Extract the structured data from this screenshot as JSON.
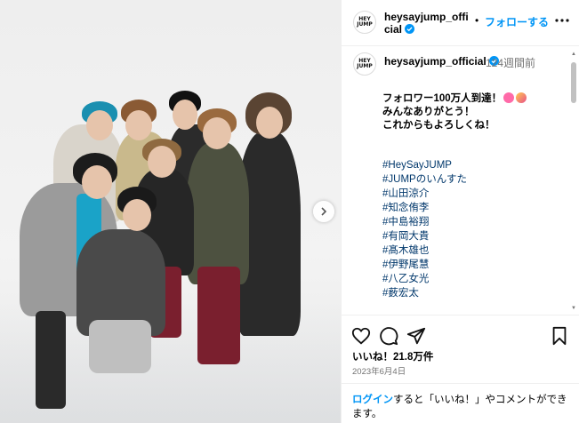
{
  "header": {
    "username": "heysayjump_official",
    "separator": "•",
    "follow_label": "フォローする",
    "logo_text": "HEY SAY JUMP"
  },
  "caption": {
    "username": "heysayjump_official",
    "time": "124週間前",
    "lines": [
      "フォロワー100万人到達！",
      "みんなありがとう！",
      "これからもよろしくね！"
    ],
    "hashtags": [
      "#HeySayJUMP",
      "#JUMPのいんすた",
      "#山田涼介",
      "#知念侑李",
      "#中島裕翔",
      "#有岡大貴",
      "#髙木雄也",
      "#伊野尾慧",
      "#八乙女光",
      "#薮宏太"
    ]
  },
  "stats": {
    "likes": "いいね！21.8万件",
    "date": "2023年6月4日"
  },
  "login_prompt": {
    "link": "ログイン",
    "text": "すると「いいね！」やコメントができます。"
  },
  "icons": {
    "like": "heart-icon",
    "comment": "comment-icon",
    "share": "send-icon",
    "save": "bookmark-icon",
    "more": "more-horizontal-icon",
    "next": "chevron-right-icon"
  },
  "colors": {
    "accent": "#0095f6",
    "hashtag": "#00376b",
    "verified": "#0095f6"
  }
}
